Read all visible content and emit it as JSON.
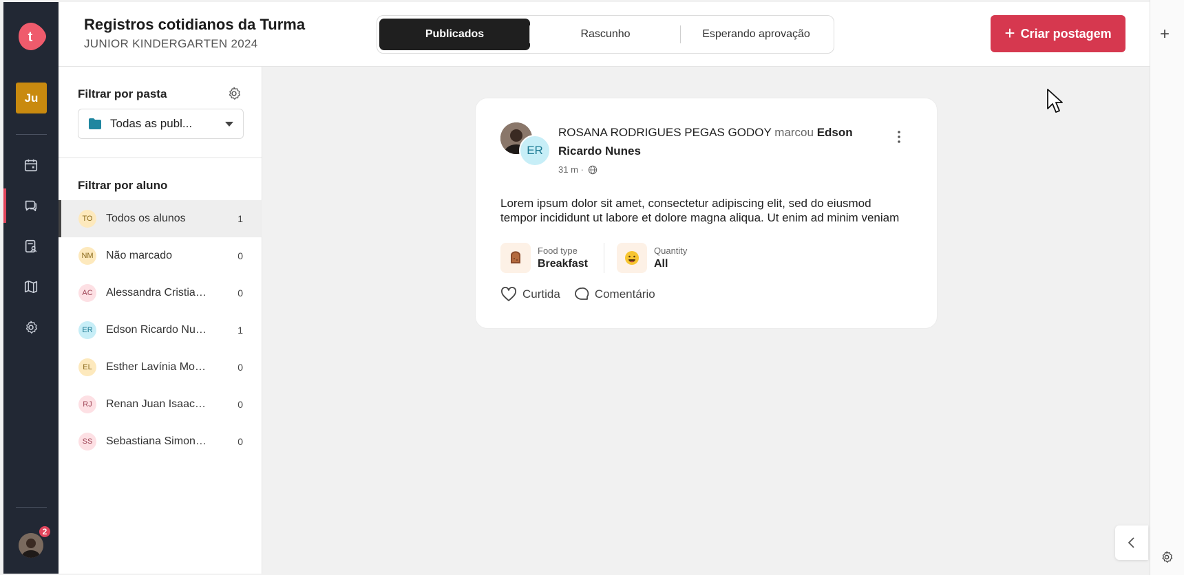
{
  "rail": {
    "logo_letter": "t",
    "class_badge": "Ju",
    "notification_count": "2",
    "nav": [
      {
        "name": "calendar-icon"
      },
      {
        "name": "chat-icon"
      },
      {
        "name": "report-icon"
      },
      {
        "name": "book-icon"
      },
      {
        "name": "settings-icon"
      }
    ]
  },
  "header": {
    "title": "Registros cotidianos da Turma",
    "subtitle": "JUNIOR KINDERGARTEN 2024",
    "tabs": [
      "Publicados",
      "Rascunho",
      "Esperando aprovação"
    ],
    "create_label": "Criar postagem"
  },
  "filters": {
    "folder_heading": "Filtrar por pasta",
    "folder_value": "Todas as publ...",
    "student_heading": "Filtrar por aluno",
    "students": [
      {
        "initials": "TO",
        "name": "Todos os alunos",
        "count": "1",
        "bg": "#fde9bd",
        "fg": "#8a6a1c"
      },
      {
        "initials": "NM",
        "name": "Não marcado",
        "count": "0",
        "bg": "#fde9bd",
        "fg": "#8a6a1c"
      },
      {
        "initials": "AC",
        "name": "Alessandra Cristiane...",
        "count": "0",
        "bg": "#fde0e4",
        "fg": "#a04859"
      },
      {
        "initials": "ER",
        "name": "Edson Ricardo Nunes",
        "count": "1",
        "bg": "#c7eef7",
        "fg": "#1e7b94"
      },
      {
        "initials": "EL",
        "name": "Esther Lavínia Moura",
        "count": "0",
        "bg": "#fde9bd",
        "fg": "#8a6a1c"
      },
      {
        "initials": "RJ",
        "name": "Renan Juan Isaac Silva",
        "count": "0",
        "bg": "#fde0e4",
        "fg": "#a04859"
      },
      {
        "initials": "SS",
        "name": "Sebastiana Simone Lima",
        "count": "0",
        "bg": "#fde0e4",
        "fg": "#a04859"
      }
    ]
  },
  "post": {
    "author": "ROSANA RODRIGUES PEGAS GODOY",
    "verb": "marcou",
    "tagged": "Edson Ricardo Nunes",
    "tagged_initials": "ER",
    "time": "31 m ·",
    "body_line1": "Lorem ipsum dolor sit amet, consectetur adipiscing elit, sed do eiusmod",
    "body_line2": "tempor incididunt ut labore et dolore magna aliqua. Ut enim ad minim veniam",
    "attributes": [
      {
        "label": "Food type",
        "value": "Breakfast",
        "icon": "toast-icon"
      },
      {
        "label": "Quantity",
        "value": "All",
        "icon": "smiley-icon"
      }
    ],
    "like_label": "Curtida",
    "comment_label": "Comentário"
  },
  "colors": {
    "rail": "#222834",
    "accent": "#d6384f",
    "badge": "#c98a0f"
  }
}
